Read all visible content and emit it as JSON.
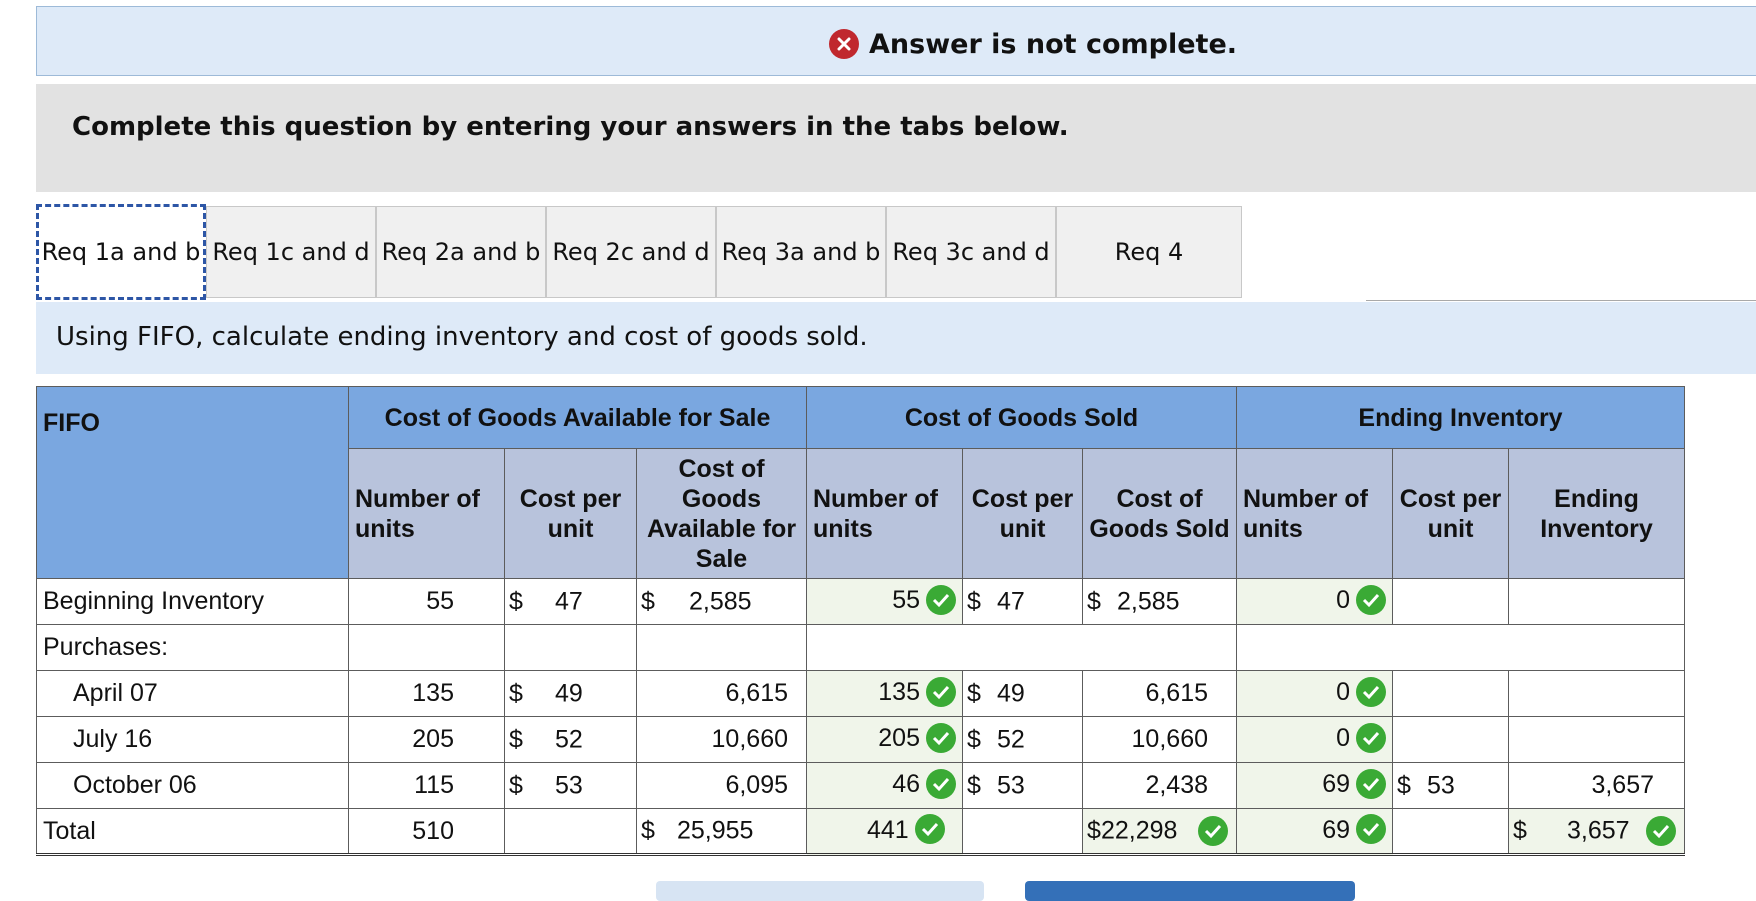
{
  "banner": {
    "text": "Answer is not complete.",
    "icon": "x-circle-icon",
    "icon_color": "#c0282e"
  },
  "instructions": "Complete this question by entering your answers in the tabs below.",
  "tabs": [
    {
      "label": "Req 1a and b",
      "active": true
    },
    {
      "label": "Req 1c and d"
    },
    {
      "label": "Req 2a and b"
    },
    {
      "label": "Req 2c and d"
    },
    {
      "label": "Req 3a and b"
    },
    {
      "label": "Req 3c and d"
    },
    {
      "label": "Req 4"
    }
  ],
  "prompt": "Using FIFO, calculate ending inventory and cost of goods sold.",
  "table": {
    "corner": "FIFO",
    "groups": {
      "available": "Cost of Goods Available for Sale",
      "cogs": "Cost of Goods Sold",
      "ending": "Ending Inventory"
    },
    "subheaders": {
      "avail_units": "Number of units",
      "avail_cost": "Cost per unit",
      "avail_total": "Cost of Goods Available for Sale",
      "cogs_units": "Number of units",
      "cogs_cost": "Cost per unit",
      "cogs_total": "Cost of Goods Sold",
      "end_units": "Number of units",
      "end_cost": "Cost per unit",
      "end_total": "Ending Inventory"
    },
    "rows": {
      "beginning": {
        "label": "Beginning Inventory",
        "units": "55",
        "cost": "47",
        "total": "2,585",
        "cogs_units": "55",
        "cogs_cost": "47",
        "cogs_total": "2,585",
        "end_units": "0"
      },
      "purchases": {
        "label": "Purchases:"
      },
      "april": {
        "label": "April 07",
        "units": "135",
        "cost": "49",
        "total": "6,615",
        "cogs_units": "135",
        "cogs_cost": "49",
        "cogs_total": "6,615",
        "end_units": "0"
      },
      "july": {
        "label": "July 16",
        "units": "205",
        "cost": "52",
        "total": "10,660",
        "cogs_units": "205",
        "cogs_cost": "52",
        "cogs_total": "10,660",
        "end_units": "0"
      },
      "october": {
        "label": "October 06",
        "units": "115",
        "cost": "53",
        "total": "6,095",
        "cogs_units": "46",
        "cogs_cost": "53",
        "cogs_total": "2,438",
        "end_units": "69",
        "end_cost": "53",
        "end_total": "3,657"
      },
      "total": {
        "label": "Total",
        "units": "510",
        "total": "25,955",
        "cogs_units": "441",
        "cogs_total": "22,298",
        "end_units": "69",
        "end_total": "3,657"
      }
    },
    "currency": "$",
    "check_color": "#3aaa35"
  }
}
